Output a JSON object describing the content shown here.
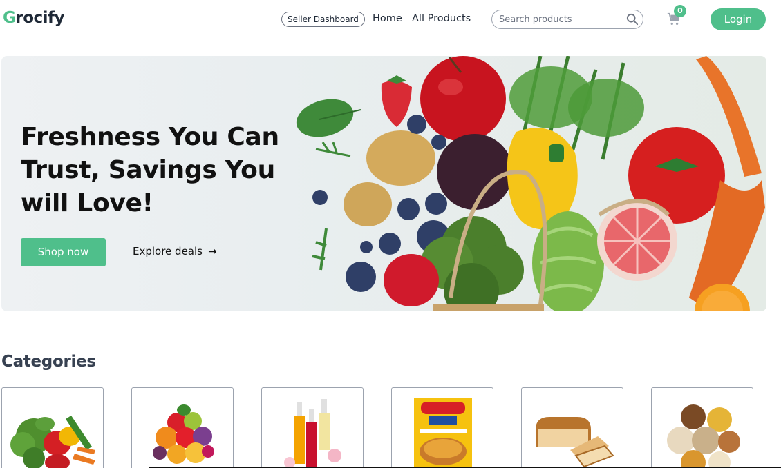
{
  "brand": {
    "first_letter": "G",
    "rest": "rocify",
    "accent": "#4fbf8b"
  },
  "nav": {
    "seller_dashboard": "Seller Dashboard",
    "home": "Home",
    "all_products": "All Products",
    "search_placeholder": "Search products",
    "cart_count": "0",
    "login": "Login"
  },
  "hero": {
    "title": "Freshness You Can Trust, Savings You will Love!",
    "shop_now": "Shop now",
    "explore_deals": "Explore deals",
    "arrow": "→"
  },
  "categories": {
    "heading": "Categories",
    "items": [
      {
        "icon": "vegetables-icon"
      },
      {
        "icon": "fruits-icon"
      },
      {
        "icon": "drinks-icon"
      },
      {
        "icon": "instant-noodles-icon"
      },
      {
        "icon": "bread-icon"
      },
      {
        "icon": "grains-icon"
      }
    ]
  }
}
